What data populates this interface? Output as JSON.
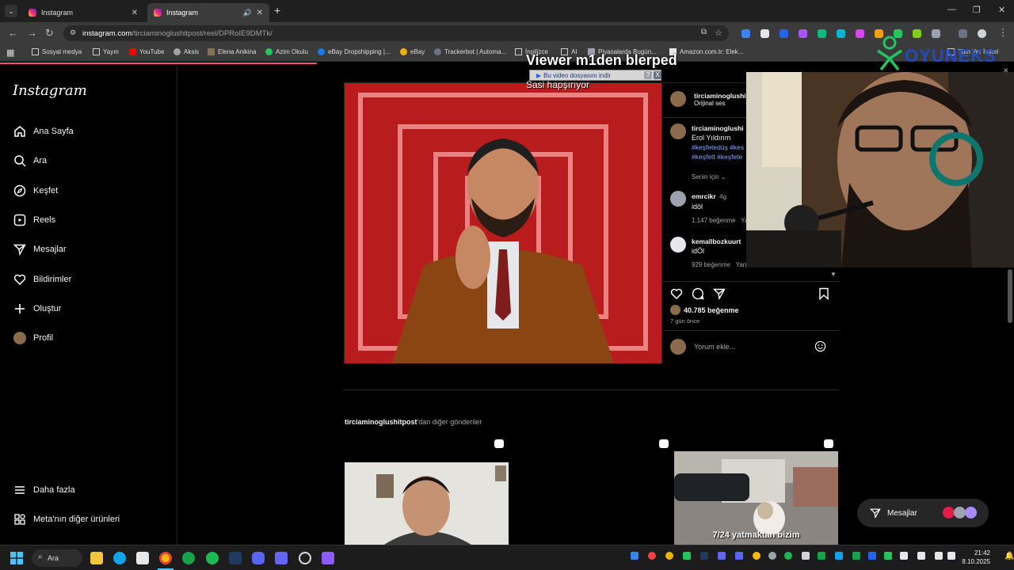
{
  "browser": {
    "tabs": [
      {
        "title": "Instagram",
        "active": false
      },
      {
        "title": "Instagram",
        "active": true
      }
    ],
    "new_tab_symbol": "+",
    "url_host": "instagram.com",
    "url_path": "/tirciaminoglushitpost/reel/DPRoIE9DMTk/",
    "bookmarks": [
      "Sosyal medya",
      "Yayın",
      "YouTube",
      "Aksis",
      "Elena Anikina",
      "Azim Okulu",
      "eBay Dropshipping |...",
      "eBay",
      "Trackerbot | Automa...",
      "İngilizce",
      "AI",
      "Piyasalarda Bugün...",
      "Amazon.com.tr: Elek..."
    ]
  },
  "instagram": {
    "logo": "Instagram",
    "nav": [
      {
        "label": "Ana Sayfa",
        "icon": "home-icon"
      },
      {
        "label": "Ara",
        "icon": "search-icon"
      },
      {
        "label": "Keşfet",
        "icon": "compass-icon"
      },
      {
        "label": "Reels",
        "icon": "reels-icon"
      },
      {
        "label": "Mesajlar",
        "icon": "send-icon"
      },
      {
        "label": "Bildirimler",
        "icon": "heart-icon"
      },
      {
        "label": "Oluştur",
        "icon": "plus-icon"
      },
      {
        "label": "Profil",
        "icon": "avatar"
      }
    ],
    "nav_bottom": [
      {
        "label": "Daha fazla",
        "icon": "menu-icon"
      },
      {
        "label": "Meta'nın diğer ürünleri",
        "icon": "meta-icon"
      }
    ],
    "post": {
      "author": "tirciaminoglushi",
      "audio": "Orijinal ses",
      "caption_author": "tirciaminoglushi",
      "caption_line": "Erol Yıldırım",
      "hashtags_1": "#keşfetedüş #kes",
      "hashtags_2": "#keşfett #keşfete",
      "sort_label": "Senin için",
      "comments": [
        {
          "user": "emrcikr",
          "age": "4g",
          "text": "idöl",
          "likes": "1.147 beğenme",
          "reply": "Ya"
        },
        {
          "user": "kemallbozkuurt",
          "age": "",
          "text": "idÖl",
          "likes": "929 beğenme",
          "reply": "Yanıtla"
        }
      ],
      "like_count": "40.785 beğenme",
      "posted": "7 gün önce",
      "comment_placeholder": "Yorum ekle..."
    },
    "more_posts_user": "tirciaminoglushitpost",
    "more_posts_suffix": "'dan diğer gönderiler",
    "thumb_caption": "7/24 yatmaktan bizim",
    "messages_pill": "Mesajlar"
  },
  "overlay": {
    "stream_alert_title": "Viewer m1den blerped",
    "stream_alert_sub": "Sasi hapşırıyor",
    "download_bar": "Bu video dosyasını indir",
    "download_help": "?",
    "download_close": "X",
    "brand": "OYUNEKS",
    "top_right_text": "Tüm Yer İmleri"
  },
  "taskbar": {
    "search_label": "Ara",
    "time": "21:42",
    "date": "8.10.2025"
  },
  "colors": {
    "ig_bg": "#000000",
    "media_red": "#c92a2e",
    "link_blue": "#8aa8ff",
    "brand_green": "#22c55e"
  }
}
